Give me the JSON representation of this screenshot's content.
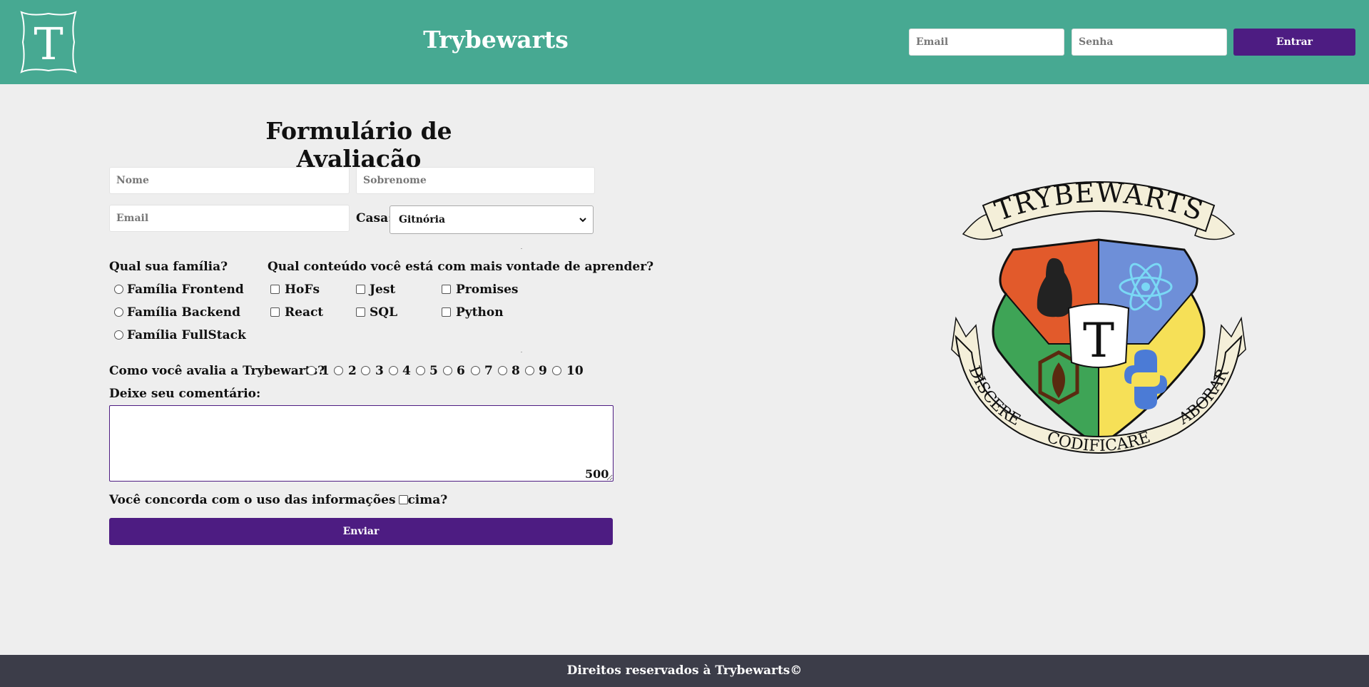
{
  "header": {
    "logo_letter": "T",
    "title": "Trybewarts",
    "email_placeholder": "Email",
    "password_placeholder": "Senha",
    "login_label": "Entrar"
  },
  "form": {
    "title": "Formulário de Avaliação",
    "name_placeholder": "Nome",
    "lastname_placeholder": "Sobrenome",
    "email_placeholder": "Email",
    "house_label": "Casa:",
    "house_selected": "Gitnória",
    "family_question": "Qual sua família?",
    "families": [
      "Família Frontend",
      "Família Backend",
      "Família FullStack"
    ],
    "content_question": "Qual conteúdo você está com mais vontade de aprender?",
    "contents": [
      "HoFs",
      "Jest",
      "Promises",
      "React",
      "SQL",
      "Python"
    ],
    "rating_question": "Como você avalia a Trybewarts?",
    "ratings": [
      "1",
      "2",
      "3",
      "4",
      "5",
      "6",
      "7",
      "8",
      "9",
      "10"
    ],
    "comment_label": "Deixe seu comentário:",
    "counter": "500",
    "agreement_label": "Você concorda com o uso das informações acima?",
    "submit_label": "Enviar"
  },
  "crest": {
    "banner_top": "TRYBEWARTS",
    "banner_left": "DISCERE",
    "banner_bottom": "CODIFICARE",
    "banner_right": "LABORARE",
    "center_letter": "T"
  },
  "footer": {
    "text": "Direitos reservados à Trybewarts©"
  },
  "colors": {
    "header_bg": "#47a992",
    "accent_purple": "#4d1c82",
    "footer_bg": "#3c3d49",
    "page_bg": "#eeeeee"
  }
}
